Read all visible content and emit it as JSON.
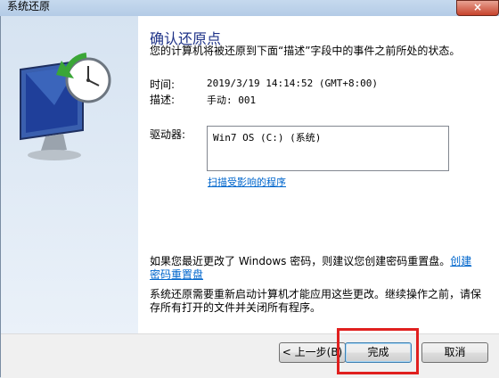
{
  "window": {
    "title": "系统还原",
    "close_glyph": "×"
  },
  "content": {
    "heading": "确认还原点",
    "description": "您的计算机将被还原到下面“描述”字段中的事件之前所处的状态。",
    "time_label": "时间:",
    "time_value": "2019/3/19 14:14:52 (GMT+8:00)",
    "desc_label": "描述:",
    "desc_value": "手动: 001",
    "drives_label": "驱动器:",
    "drives": [
      "Win7 OS (C:) (系统)"
    ],
    "scan_link": "扫描受影响的程序",
    "password_text": "如果您最近更改了 Windows 密码，则建议您创建密码重置盘。",
    "password_link": "创建密码重置盘",
    "restart_text": "系统还原需要重新启动计算机才能应用这些更改。继续操作之前，请保存所有打开的文件并关闭所有程序。"
  },
  "buttons": {
    "back": "< 上一步(B)",
    "finish": "完成",
    "cancel": "取消"
  },
  "colors": {
    "heading": "#1e3287",
    "link": "#0066cc",
    "highlight": "#e0201f"
  }
}
